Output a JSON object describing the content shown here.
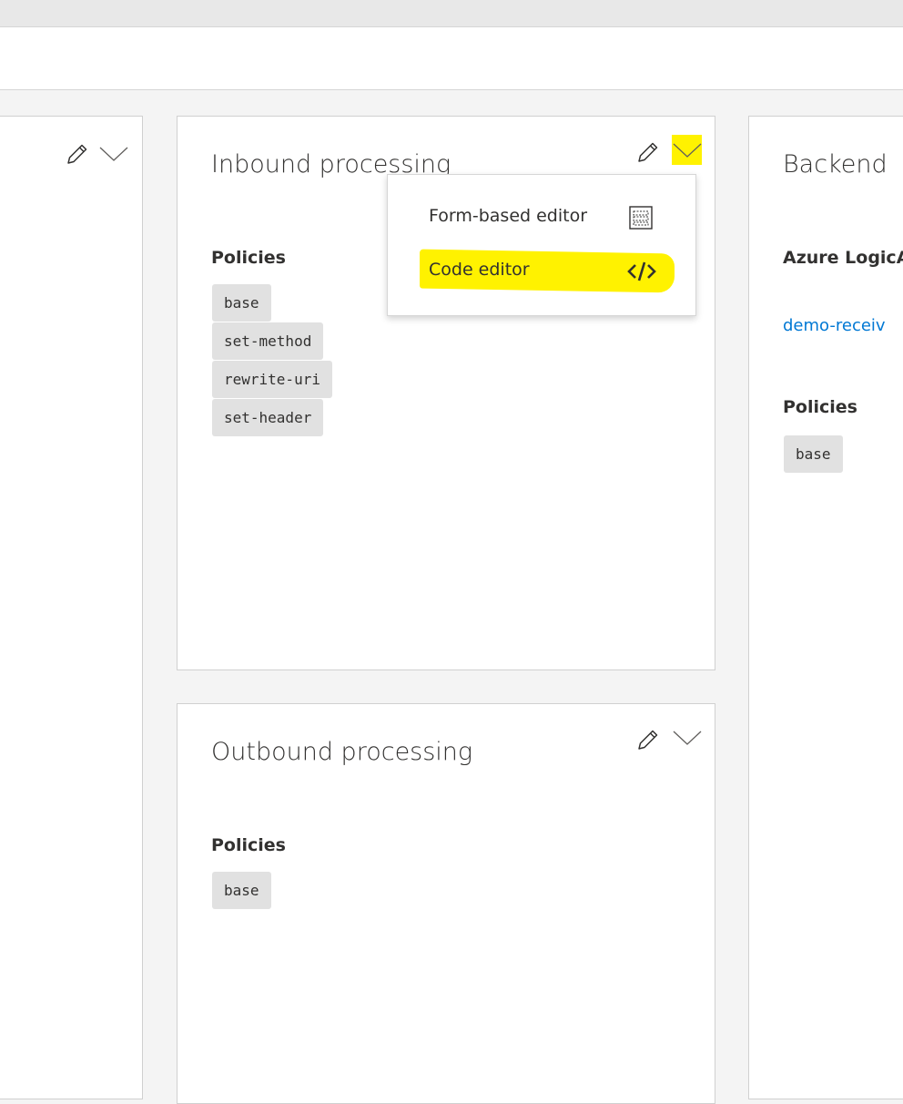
{
  "frontend": {},
  "inbound": {
    "title": "Inbound processing",
    "policies_label": "Policies",
    "policies": [
      "base",
      "set-method",
      "rewrite-uri",
      "set-header"
    ]
  },
  "inbound_menu": {
    "items": [
      {
        "label": "Form-based editor",
        "icon": "form-editor-icon"
      },
      {
        "label": "Code editor",
        "icon": "code-icon",
        "highlighted": true
      }
    ],
    "highlight_color": "#fff200"
  },
  "outbound": {
    "title": "Outbound processing",
    "policies_label": "Policies",
    "policies": [
      "base"
    ]
  },
  "backend": {
    "title": "Backend",
    "service_label": "Azure LogicA",
    "service_link": "demo-receiv",
    "policies_label": "Policies",
    "policies": [
      "base"
    ]
  },
  "colors": {
    "link": "#0078d4",
    "chip_bg": "#e1e1e1",
    "highlight": "#fff200"
  }
}
